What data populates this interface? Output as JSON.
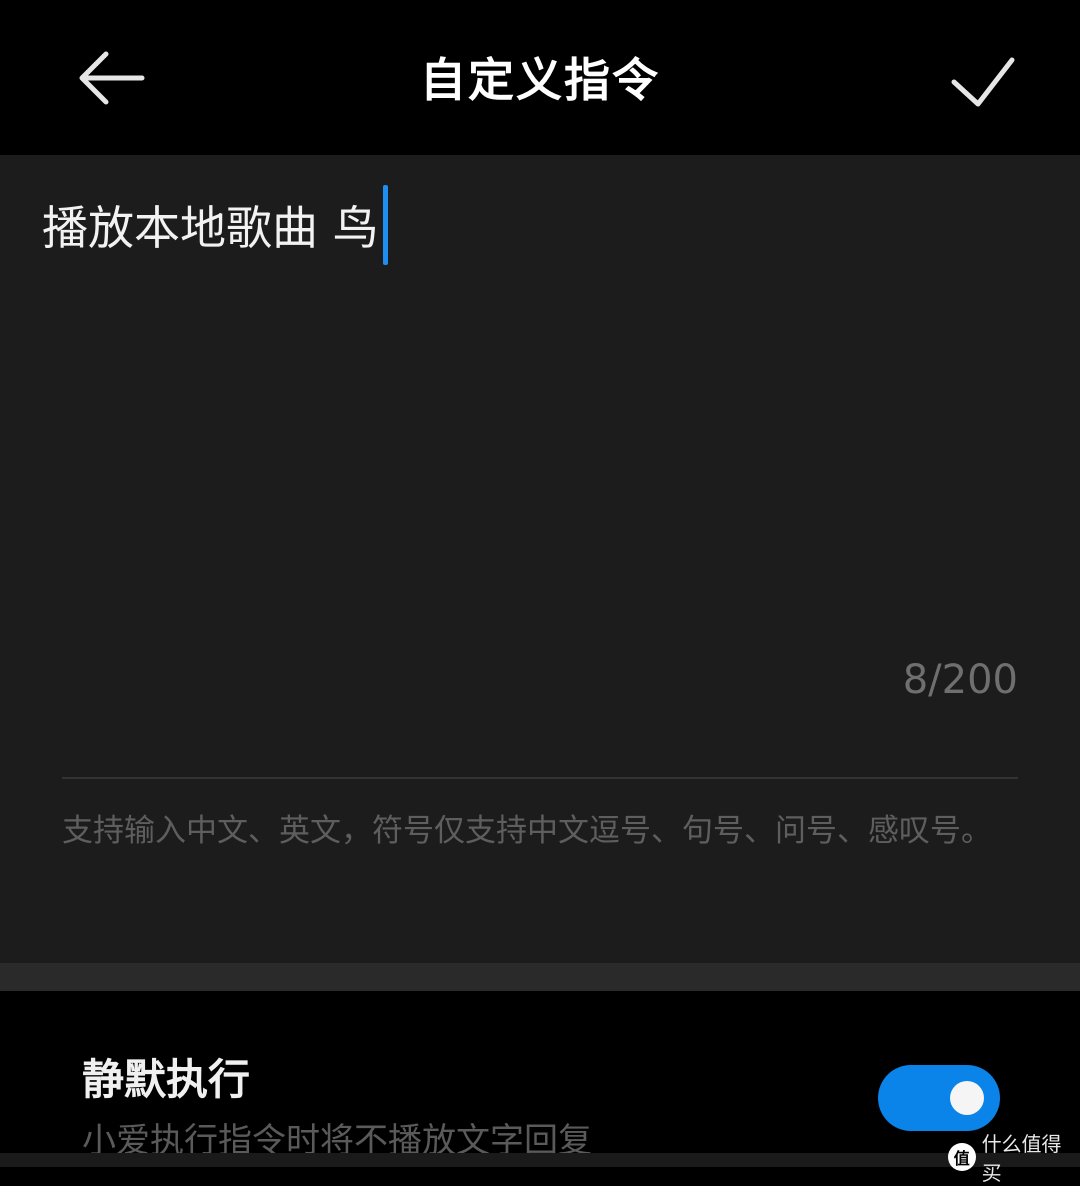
{
  "header": {
    "title": "自定义指令",
    "back_icon": "arrow-left-icon",
    "confirm_icon": "check-icon"
  },
  "editor": {
    "value": "播放本地歌曲 鸟",
    "counter": "8/200",
    "hint": "支持输入中文、英文，符号仅支持中文逗号、句号、问号、感叹号。",
    "caret_color": "#1e8ff0"
  },
  "settings": {
    "silent": {
      "title": "静默执行",
      "description": "小爱执行指令时将不播放文字回复",
      "enabled": true,
      "accent_color": "#0a84e8"
    }
  },
  "watermark": {
    "logo_text": "值",
    "text": "什么值得买"
  }
}
